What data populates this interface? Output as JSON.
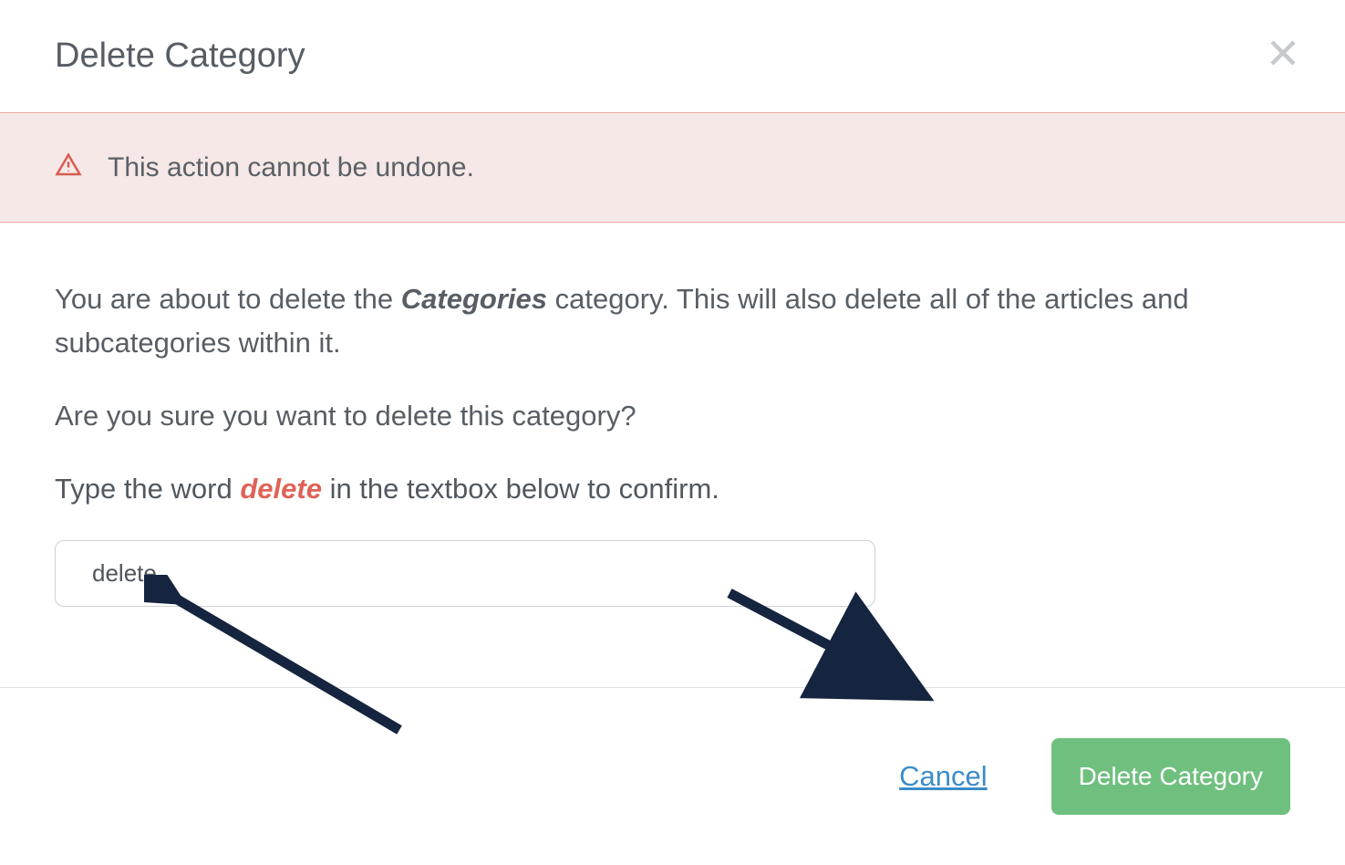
{
  "modal": {
    "title": "Delete Category",
    "alert": "This action cannot be undone.",
    "body": {
      "intro_pre": "You are about to delete the ",
      "intro_bold": "Categories",
      "intro_post": " category. This will also delete all of the articles and subcategories within it.",
      "question": "Are you sure you want to delete this category?",
      "instruction_pre": "Type the word ",
      "instruction_word": "delete",
      "instruction_post": " in the textbox below to confirm."
    },
    "input_value": "delete",
    "footer": {
      "cancel": "Cancel",
      "confirm": "Delete Category"
    }
  }
}
